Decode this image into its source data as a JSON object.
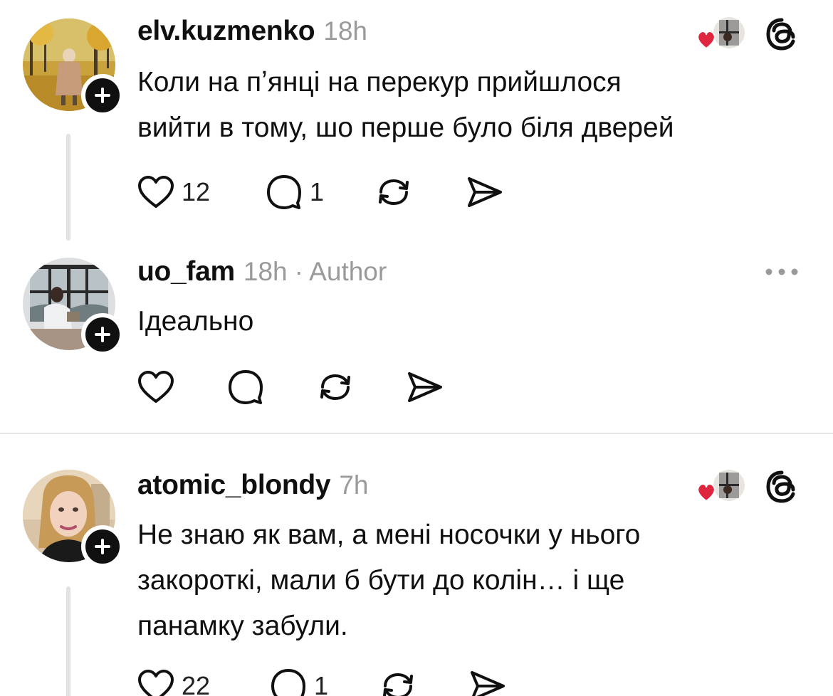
{
  "posts": [
    {
      "username": "elv.kuzmenko",
      "time": "18h",
      "lines": [
        "Коли на пʼянці на перекур прийшлося",
        "вийти в тому, шо перше було біля дверей"
      ],
      "likes": "12",
      "replies": "1",
      "liked_by_author_icon": "heart-avatar-icon",
      "top_icon": "threads-logo-icon"
    },
    {
      "username": "uo_fam",
      "time": "18h",
      "author_tag": "· Author",
      "lines": [
        "Ідеально"
      ],
      "top_icon": "more-options-icon"
    },
    {
      "username": "atomic_blondy",
      "time": "7h",
      "lines": [
        "Не знаю як вам, а мені носочки у нього",
        "закороткі, мали б бути до колін… і ще",
        "панамку забули."
      ],
      "likes": "22",
      "replies": "1",
      "liked_by_author_icon": "heart-avatar-icon",
      "top_icon": "threads-logo-icon"
    }
  ],
  "colors": {
    "text": "#101010",
    "muted": "#9a9a9a",
    "heart": "#e0263e",
    "divider": "#e6e6e6"
  }
}
